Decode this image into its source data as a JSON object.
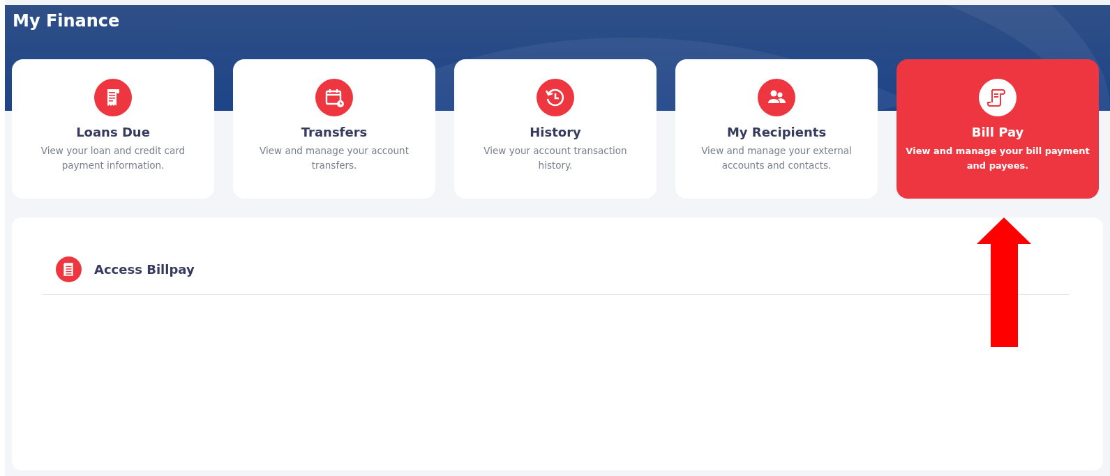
{
  "header": {
    "title": "My Finance"
  },
  "cards": [
    {
      "title": "Loans Due",
      "description": "View your loan and credit card payment information.",
      "selected": false
    },
    {
      "title": "Transfers",
      "description": "View and manage your account transfers.",
      "selected": false
    },
    {
      "title": "History",
      "description": "View your account transaction history.",
      "selected": false
    },
    {
      "title": "My Recipients",
      "description": "View and manage your external accounts and contacts.",
      "selected": false
    },
    {
      "title": "Bill Pay",
      "description": "View and manage your bill payment and payees.",
      "selected": true
    }
  ],
  "panel": {
    "title": "Access Billpay"
  }
}
